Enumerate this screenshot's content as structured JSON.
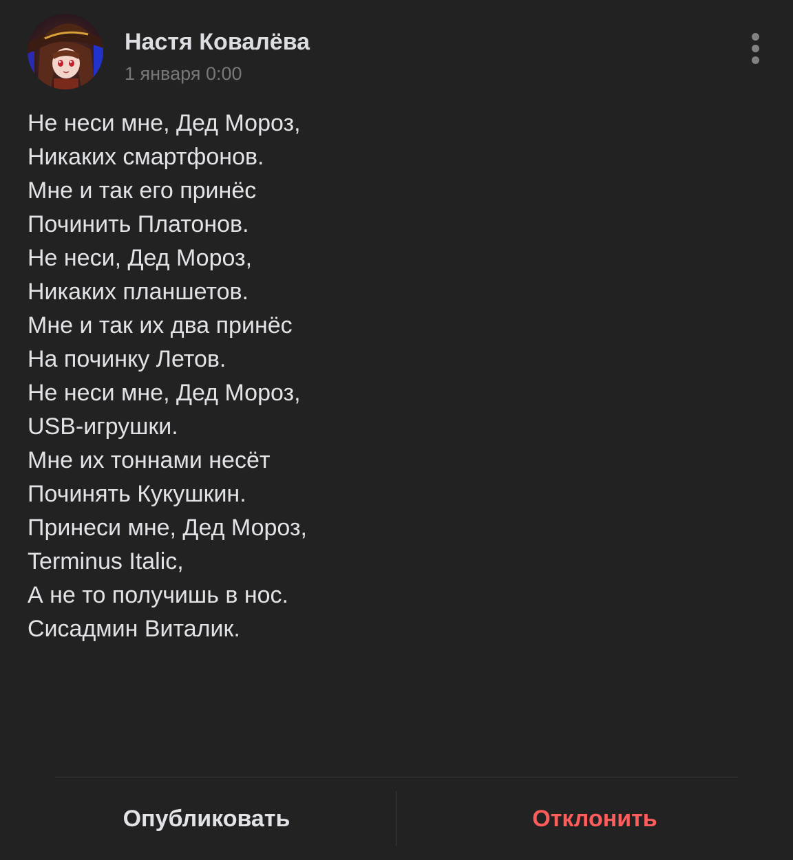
{
  "post": {
    "author": "Настя Ковалёва",
    "date": "1 января 0:00",
    "text": "Не неси мне, Дед Мороз,\nНикаких смартфонов.\nМне и так его принёс\nПочинить Платонов.\nНе неси, Дед Мороз,\nНикаких планшетов.\nМне и так их два принёс\nНа починку Летов.\nНе неси мне, Дед Мороз,\nUSB-игрушки.\nМне их тоннами несёт\nПочинять Кукушкин.\nПринеси мне, Дед Мороз,\nTerminus Italic,\nА не то получишь в нос.\nСисадмин Виталик."
  },
  "icons": {
    "more": "more-vertical-icon",
    "avatar": "avatar-image"
  },
  "actions": {
    "publish_label": "Опубликовать",
    "reject_label": "Отклонить"
  },
  "colors": {
    "background": "#222222",
    "reject": "#ff5c5c",
    "muted": "#76787a"
  }
}
